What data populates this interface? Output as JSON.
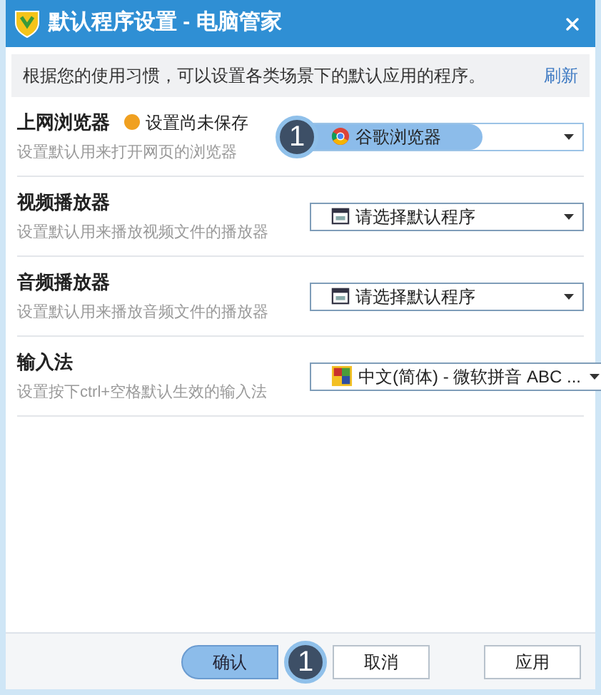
{
  "window": {
    "title": "默认程序设置 - 电脑管家"
  },
  "info": {
    "text": "根据您的使用习惯，可以设置各类场景下的默认应用的程序。",
    "link": "刷新"
  },
  "settings": [
    {
      "title": "上网浏览器",
      "warning": "设置尚未保存",
      "description": "设置默认用来打开网页的浏览器",
      "value": "谷歌浏览器",
      "kind": "browser",
      "highlighted": true,
      "callout": "1"
    },
    {
      "title": "视频播放器",
      "description": "设置默认用来播放视频文件的播放器",
      "value": "请选择默认程序",
      "kind": "program",
      "highlighted": false
    },
    {
      "title": "音频播放器",
      "description": "设置默认用来播放音频文件的播放器",
      "value": "请选择默认程序",
      "kind": "program",
      "highlighted": false
    },
    {
      "title": "输入法",
      "description": "设置按下ctrl+空格默认生效的输入法",
      "value": "中文(简体) - 微软拼音 ABC ...",
      "kind": "ime",
      "highlighted": false
    }
  ],
  "buttons": [
    {
      "label": "确认",
      "highlighted": true,
      "callout": "1"
    },
    {
      "label": "取消",
      "highlighted": false
    },
    {
      "label": "应用",
      "highlighted": false
    }
  ]
}
